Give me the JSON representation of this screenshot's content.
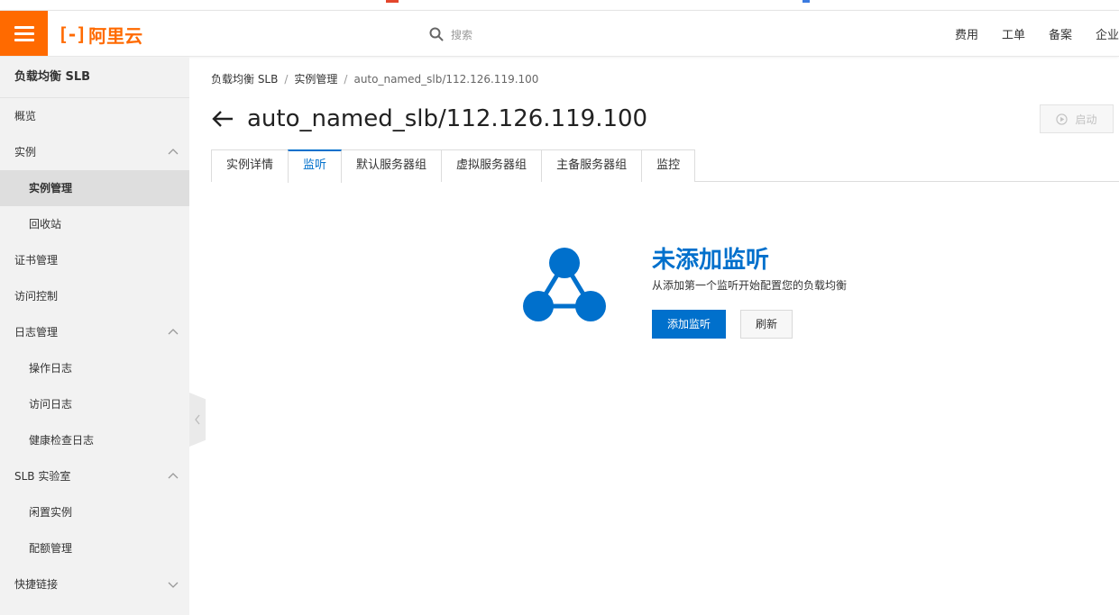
{
  "header": {
    "logo_mark": "[-]",
    "logo_text": "阿里云",
    "search_placeholder": "搜索",
    "nav": [
      "费用",
      "工单",
      "备案",
      "企业"
    ]
  },
  "sidebar": {
    "title": "负载均衡 SLB",
    "items": [
      {
        "label": "概览",
        "level": 1
      },
      {
        "label": "实例",
        "level": 1,
        "expand": "up"
      },
      {
        "label": "实例管理",
        "level": 2,
        "active": true
      },
      {
        "label": "回收站",
        "level": 2
      },
      {
        "label": "证书管理",
        "level": 1
      },
      {
        "label": "访问控制",
        "level": 1
      },
      {
        "label": "日志管理",
        "level": 1,
        "expand": "up"
      },
      {
        "label": "操作日志",
        "level": 2
      },
      {
        "label": "访问日志",
        "level": 2
      },
      {
        "label": "健康检查日志",
        "level": 2
      },
      {
        "label": "SLB 实验室",
        "level": 1,
        "expand": "up"
      },
      {
        "label": "闲置实例",
        "level": 2
      },
      {
        "label": "配额管理",
        "level": 2
      },
      {
        "label": "快捷链接",
        "level": 1,
        "expand": "down"
      }
    ]
  },
  "breadcrumb": {
    "items": [
      "负载均衡 SLB",
      "实例管理",
      "auto_named_slb/112.126.119.100"
    ],
    "separator": "/"
  },
  "page": {
    "title": "auto_named_slb/112.126.119.100",
    "start_label": "启动"
  },
  "tabs": [
    {
      "label": "实例详情",
      "active": false
    },
    {
      "label": "监听",
      "active": true
    },
    {
      "label": "默认服务器组",
      "active": false
    },
    {
      "label": "虚拟服务器组",
      "active": false
    },
    {
      "label": "主备服务器组",
      "active": false
    },
    {
      "label": "监控",
      "active": false
    }
  ],
  "empty_state": {
    "title": "未添加监听",
    "description": "从添加第一个监听开始配置您的负载均衡",
    "primary_button": "添加监听",
    "secondary_button": "刷新"
  },
  "colors": {
    "brand_orange": "#ff6a00",
    "primary_blue": "#0070cc"
  }
}
